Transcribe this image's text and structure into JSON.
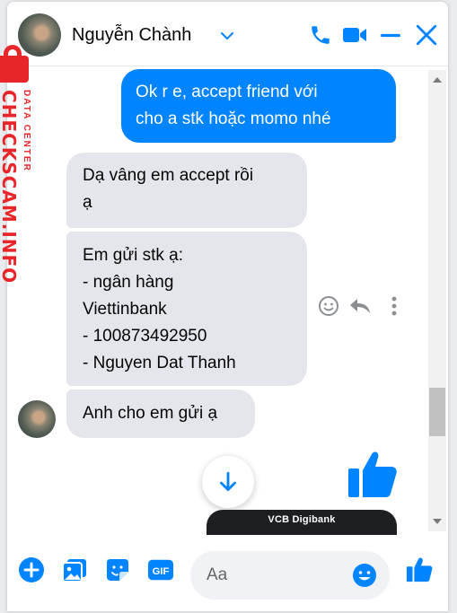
{
  "header": {
    "contact_name": "Nguyễn Chành"
  },
  "watermark": {
    "brand": "CHECKSCAM.INFO",
    "sub": "DATA CENTER"
  },
  "messages": [
    {
      "direction": "outgoing",
      "text": "Ok r e, accept friend với\ncho a stk hoặc momo nhé"
    },
    {
      "direction": "incoming",
      "text": "Dạ vâng em accept rồi\nạ"
    },
    {
      "direction": "incoming",
      "text": "Em gửi stk ạ:\n- ngân hàng\nViettinbank\n- 100873492950\n- Nguyen Dat Thanh"
    },
    {
      "direction": "incoming",
      "text": "Anh cho em gửi ạ"
    }
  ],
  "image_preview": {
    "label": "VCB Digibank"
  },
  "composer": {
    "placeholder": "Aa"
  },
  "colors": {
    "accent": "#0084ff",
    "incoming_bubble": "#e4e6eb",
    "watermark_red": "#e8262a"
  },
  "icons": {
    "header": [
      "chevron-down-icon",
      "phone-icon",
      "video-icon",
      "minimize-icon",
      "close-icon"
    ],
    "message_actions": [
      "emoji-react-icon",
      "reply-icon",
      "more-icon"
    ],
    "composer": [
      "plus-icon",
      "photo-icon",
      "sticker-icon",
      "gif-icon",
      "emoji-icon",
      "like-icon"
    ]
  }
}
